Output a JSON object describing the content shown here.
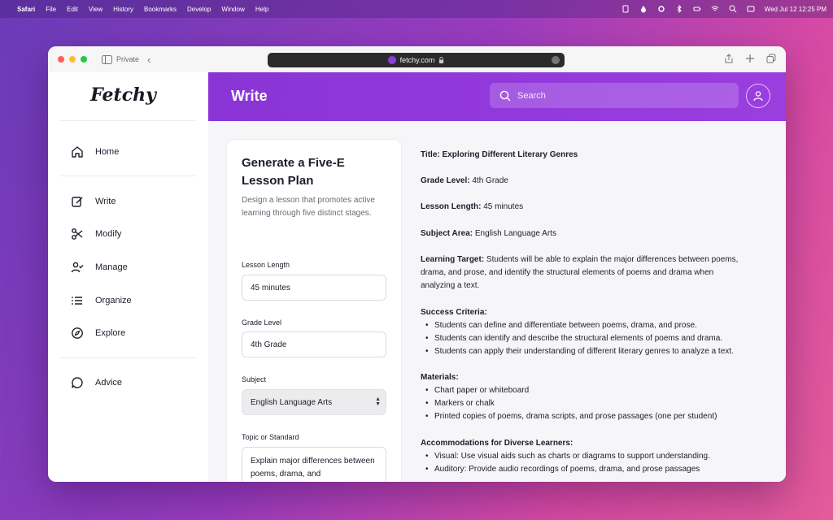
{
  "menubar": {
    "app": "Safari",
    "menus": [
      "File",
      "Edit",
      "View",
      "History",
      "Bookmarks",
      "Develop",
      "Window",
      "Help"
    ],
    "clock": "Wed Jul 12  12:25 PM"
  },
  "browser": {
    "sidebar_label": "Private",
    "url": "fetchy.com"
  },
  "sidebar": {
    "logo": "Fetchy",
    "items": [
      {
        "label": "Home",
        "icon": "home-icon"
      },
      {
        "label": "Write",
        "icon": "pencil-icon"
      },
      {
        "label": "Modify",
        "icon": "scissors-icon"
      },
      {
        "label": "Manage",
        "icon": "user-check-icon"
      },
      {
        "label": "Organize",
        "icon": "list-icon"
      },
      {
        "label": "Explore",
        "icon": "compass-icon"
      },
      {
        "label": "Advice",
        "icon": "chat-icon"
      }
    ]
  },
  "header": {
    "title": "Write",
    "search_placeholder": "Search"
  },
  "form": {
    "title": "Generate a Five-E Lesson Plan",
    "description": "Design a lesson that promotes active learning through five distinct stages.",
    "lesson_length_label": "Lesson Length",
    "lesson_length_value": "45 minutes",
    "grade_level_label": "Grade Level",
    "grade_level_value": "4th Grade",
    "subject_label": "Subject",
    "subject_value": "English Language Arts",
    "topic_label": "Topic or Standard",
    "topic_value": "Explain major differences between poems, drama, and"
  },
  "output": {
    "title_label": "Title:",
    "title_value": "Exploring Different Literary Genres",
    "grade_label": "Grade Level:",
    "grade_value": " 4th Grade",
    "length_label": "Lesson Length:",
    "length_value": " 45 minutes",
    "subject_label": "Subject Area:",
    "subject_value": " English Language Arts",
    "target_label": "Learning Target:",
    "target_value": " Students will be able to explain the major differences between poems, drama, and prose, and identify the structural elements of poems and drama when analyzing a text.",
    "success_label": "Success Criteria:",
    "success_items": [
      "Students can define and differentiate between poems, drama, and prose.",
      "Students can identify and describe the structural elements of poems and drama.",
      "Students can apply their understanding of different literary genres to analyze a text."
    ],
    "materials_label": "Materials:",
    "materials_items": [
      "Chart paper or whiteboard",
      "Markers or chalk",
      "Printed copies of poems, drama scripts, and prose passages (one per student)"
    ],
    "accommodations_label": "Accommodations for Diverse Learners:",
    "accommodations_items": [
      "Visual: Use visual aids such as charts or diagrams to support understanding.",
      "Auditory: Provide audio recordings of poems, drama, and prose passages"
    ]
  },
  "colors": {
    "accent": "#8a34d6",
    "content_bg": "#f6f6f9"
  }
}
